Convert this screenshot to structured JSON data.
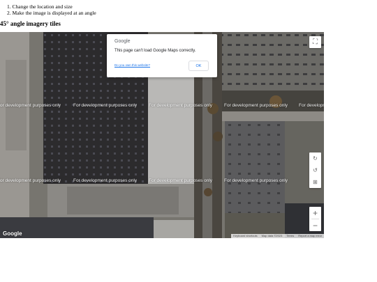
{
  "instructions": {
    "steps": [
      "1. Change the location and size",
      "2. Make the image is displayed at an angle"
    ]
  },
  "heading": "45° angle imagery tiles",
  "map": {
    "watermark_text": "For development purposes only",
    "dialog": {
      "logo": "Google",
      "message": "This page can't load Google Maps correctly.",
      "link": "Do you own this website?",
      "ok_label": "OK"
    },
    "controls": {
      "fullscreen_icon": "⛶",
      "rotate_cw_icon": "↻",
      "rotate_ccw_icon": "↺",
      "tilt_icon": "⊞",
      "zoom_in_label": "+",
      "zoom_out_label": "−"
    },
    "google_logo": "Google",
    "attribution": {
      "shortcuts": "Keyboard shortcuts",
      "map_data": "Map data ©2023",
      "terms": "Terms",
      "report": "Report a map error"
    }
  }
}
